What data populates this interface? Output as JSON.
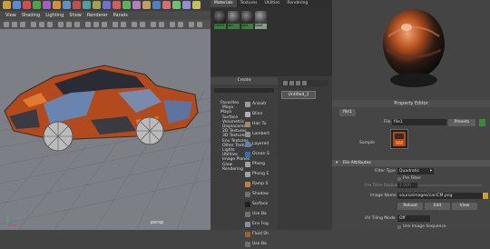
{
  "viewport": {
    "menu": [
      "View",
      "Shading",
      "Lighting",
      "Show",
      "Renderer",
      "Panels"
    ],
    "camera_label": "persp"
  },
  "center": {
    "tabs": [
      "Materials",
      "Textures",
      "Utilities",
      "Rendering"
    ],
    "swatches": [
      {
        "label": "CarSG",
        "color": "#3a7d3a"
      },
      {
        "label": "lam",
        "color": "#3a7d3a"
      },
      {
        "label": "part",
        "color": "#3a7d3a"
      },
      {
        "label": "shad",
        "color": "#8a9a8a"
      }
    ],
    "create": {
      "title": "Create",
      "categories": [
        "Favorites",
        "Maya",
        "Maya",
        "Surface",
        "Volumetric",
        "Displacement",
        "2D Textures",
        "3D Textures",
        "Env Textures",
        "Other Textures",
        "Lights",
        "Utilities",
        "Image Planes",
        "Glow",
        "Rendering"
      ],
      "nodes": [
        {
          "label": "Anisotr",
          "color": "#9a9aa5"
        },
        {
          "label": "Blinn",
          "color": "#b0b0b8"
        },
        {
          "label": "Hair Tu",
          "color": "#a08a60"
        },
        {
          "label": "Lambert",
          "color": "#909098"
        },
        {
          "label": "Layered",
          "color": "#6080b0"
        },
        {
          "label": "Ocean S",
          "color": "#3070b0"
        },
        {
          "label": "Phong",
          "color": "#a0a0a8"
        },
        {
          "label": "Phong E",
          "color": "#a0a0a8"
        },
        {
          "label": "Ramp S",
          "color": "#c08040"
        },
        {
          "label": "Shadow",
          "color": "#707070"
        },
        {
          "label": "Surface",
          "color": "#202020"
        },
        {
          "label": "Use Ba",
          "color": "#707070"
        },
        {
          "label": "Env Fog",
          "color": "#8090a0"
        },
        {
          "label": "Fluid Sh",
          "color": "#a06030"
        },
        {
          "label": "Use Ba",
          "color": "#707070"
        }
      ]
    },
    "graph_tab": "Untitled_1"
  },
  "editor": {
    "title": "Property Editor",
    "node_tab": "file1",
    "file_label": "File",
    "file_value": "file1",
    "presets_label": "Presets",
    "sample_label": "Sample",
    "attr_section": "File Attributes",
    "filter_type_label": "Filter Type",
    "filter_type_value": "Quadratic",
    "pre_filter_label": "Pre Filter",
    "pre_filter_radius_label": "Pre Filter Radius",
    "pre_filter_radius_value": "2.000",
    "image_name_label": "Image Name",
    "image_name_value": "sourceimages/car/CM.png",
    "buttons": [
      "Reload",
      "Edit",
      "View"
    ],
    "uv_tiling_label": "UV Tiling Mode",
    "uv_tiling_value": "Off",
    "use_sequence_label": "Use Image Sequence"
  }
}
